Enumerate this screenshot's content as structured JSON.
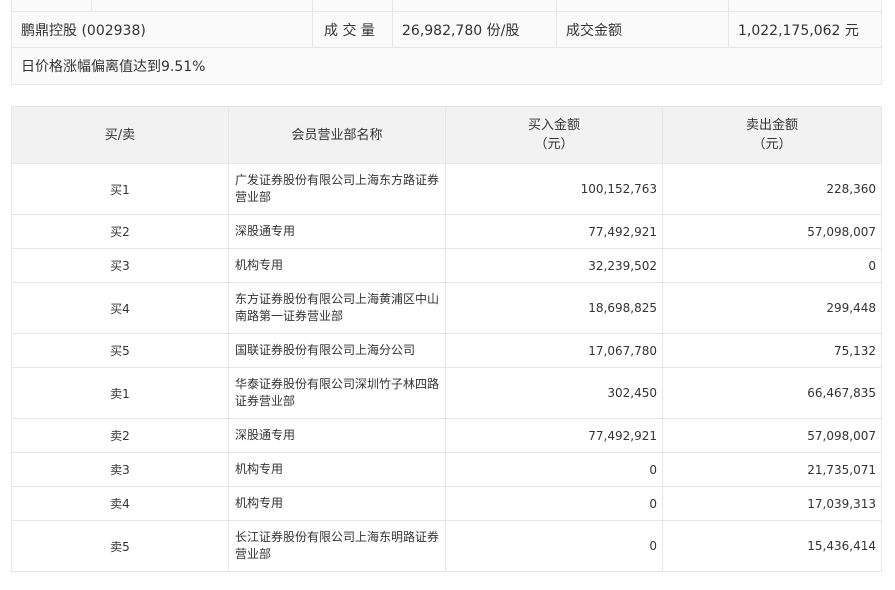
{
  "summary": {
    "stock_name": "鹏鼎控股 (002938)",
    "volume_label": "成 交 量",
    "volume_value": "26,982,780 份/股",
    "amount_label": "成交金额",
    "amount_value": "1,022,175,062 元",
    "note": "日价格涨幅偏离值达到9.51%"
  },
  "table": {
    "headers": {
      "side": "买/卖",
      "dept": "会员营业部名称",
      "buy_line1": "买入金额",
      "buy_line2": "（元）",
      "sell_line1": "卖出金额",
      "sell_line2": "（元）"
    },
    "rows": [
      {
        "side": "买1",
        "name": "广发证券股份有限公司上海东方路证券营业部",
        "buy": "100,152,763",
        "sell": "228,360"
      },
      {
        "side": "买2",
        "name": "深股通专用",
        "buy": "77,492,921",
        "sell": "57,098,007"
      },
      {
        "side": "买3",
        "name": "机构专用",
        "buy": "32,239,502",
        "sell": "0"
      },
      {
        "side": "买4",
        "name": "东方证券股份有限公司上海黄浦区中山南路第一证券营业部",
        "buy": "18,698,825",
        "sell": "299,448"
      },
      {
        "side": "买5",
        "name": "国联证券股份有限公司上海分公司",
        "buy": "17,067,780",
        "sell": "75,132"
      },
      {
        "side": "卖1",
        "name": "华泰证券股份有限公司深圳竹子林四路证券营业部",
        "buy": "302,450",
        "sell": "66,467,835"
      },
      {
        "side": "卖2",
        "name": "深股通专用",
        "buy": "77,492,921",
        "sell": "57,098,007"
      },
      {
        "side": "卖3",
        "name": "机构专用",
        "buy": "0",
        "sell": "21,735,071"
      },
      {
        "side": "卖4",
        "name": "机构专用",
        "buy": "0",
        "sell": "17,039,313"
      },
      {
        "side": "卖5",
        "name": "长江证券股份有限公司上海东明路证券营业部",
        "buy": "0",
        "sell": "15,436,414"
      }
    ]
  }
}
